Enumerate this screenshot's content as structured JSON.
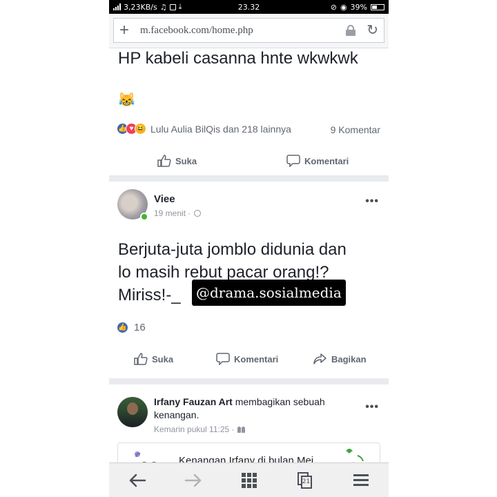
{
  "status_bar": {
    "network_speed": "3,23KB/s",
    "time": "23.32",
    "battery": "39%"
  },
  "browser": {
    "url": "m.facebook.com/home.php"
  },
  "feed": {
    "post1": {
      "text": "HP kabeli casanna hnte wkwkwk",
      "emoji": "😹",
      "reactions_summary": "Lulu Aulia BilQis dan 218 lainnya",
      "comment_count": "9 Komentar",
      "actions": {
        "like": "Suka",
        "comment": "Komentari"
      }
    },
    "post2": {
      "author": "Viee",
      "time": "19 menit",
      "text_line1": "Berjuta-juta jomblo didunia dan",
      "text_line2": "lo masih rebut pacar orang!?",
      "text_line3": "Miriss!-_",
      "watermark": "@drama.sosialmedia",
      "like_count": "16",
      "actions": {
        "like": "Suka",
        "comment": "Komentari",
        "share": "Bagikan"
      }
    },
    "post3": {
      "author": "Irfany Fauzan Art",
      "headline_rest": "membagikan sebuah kenangan.",
      "time": "Kemarin pukul 11:25",
      "memory_title": "Kenangan Irfany di bulan Mei"
    }
  },
  "icons": {
    "like": "thumb-icon",
    "comment": "speech-bubble-icon",
    "share": "share-arrow-icon",
    "more": "more-dots-icon"
  },
  "colors": {
    "facebook_blue": "#4267b2",
    "love_red": "#f33e58",
    "haha_yellow": "#f7b125",
    "online_green": "#42b72a"
  }
}
